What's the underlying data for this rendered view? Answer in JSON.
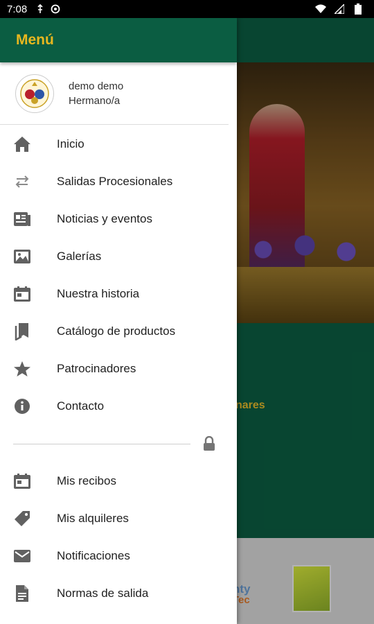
{
  "status_bar": {
    "time": "7:08"
  },
  "drawer": {
    "title": "Menú",
    "profile": {
      "name": "demo demo",
      "role": "Hermano/a"
    },
    "items": [
      {
        "label": "Inicio",
        "icon": "home-icon"
      },
      {
        "label": "Salidas Procesionales",
        "icon": "swap-arrows-icon"
      },
      {
        "label": "Noticias y eventos",
        "icon": "newspaper-icon"
      },
      {
        "label": "Galerías",
        "icon": "gallery-icon"
      },
      {
        "label": "Nuestra historia",
        "icon": "calendar-icon"
      },
      {
        "label": "Catálogo de productos",
        "icon": "bookmarks-icon"
      },
      {
        "label": "Patrocinadores",
        "icon": "star-icon"
      },
      {
        "label": "Contacto",
        "icon": "info-icon"
      }
    ],
    "private_items": [
      {
        "label": "Mis recibos",
        "icon": "calendar-icon"
      },
      {
        "label": "Mis alquileres",
        "icon": "tag-icon"
      },
      {
        "label": "Notificaciones",
        "icon": "mail-icon"
      },
      {
        "label": "Normas de salida",
        "icon": "document-icon"
      }
    ]
  },
  "background": {
    "link_fragment": "nares",
    "sponsor_text_top": "nty",
    "sponsor_text_bottom": "Tec"
  },
  "colors": {
    "primary": "#0b5d42",
    "accent": "#e8b71f"
  }
}
